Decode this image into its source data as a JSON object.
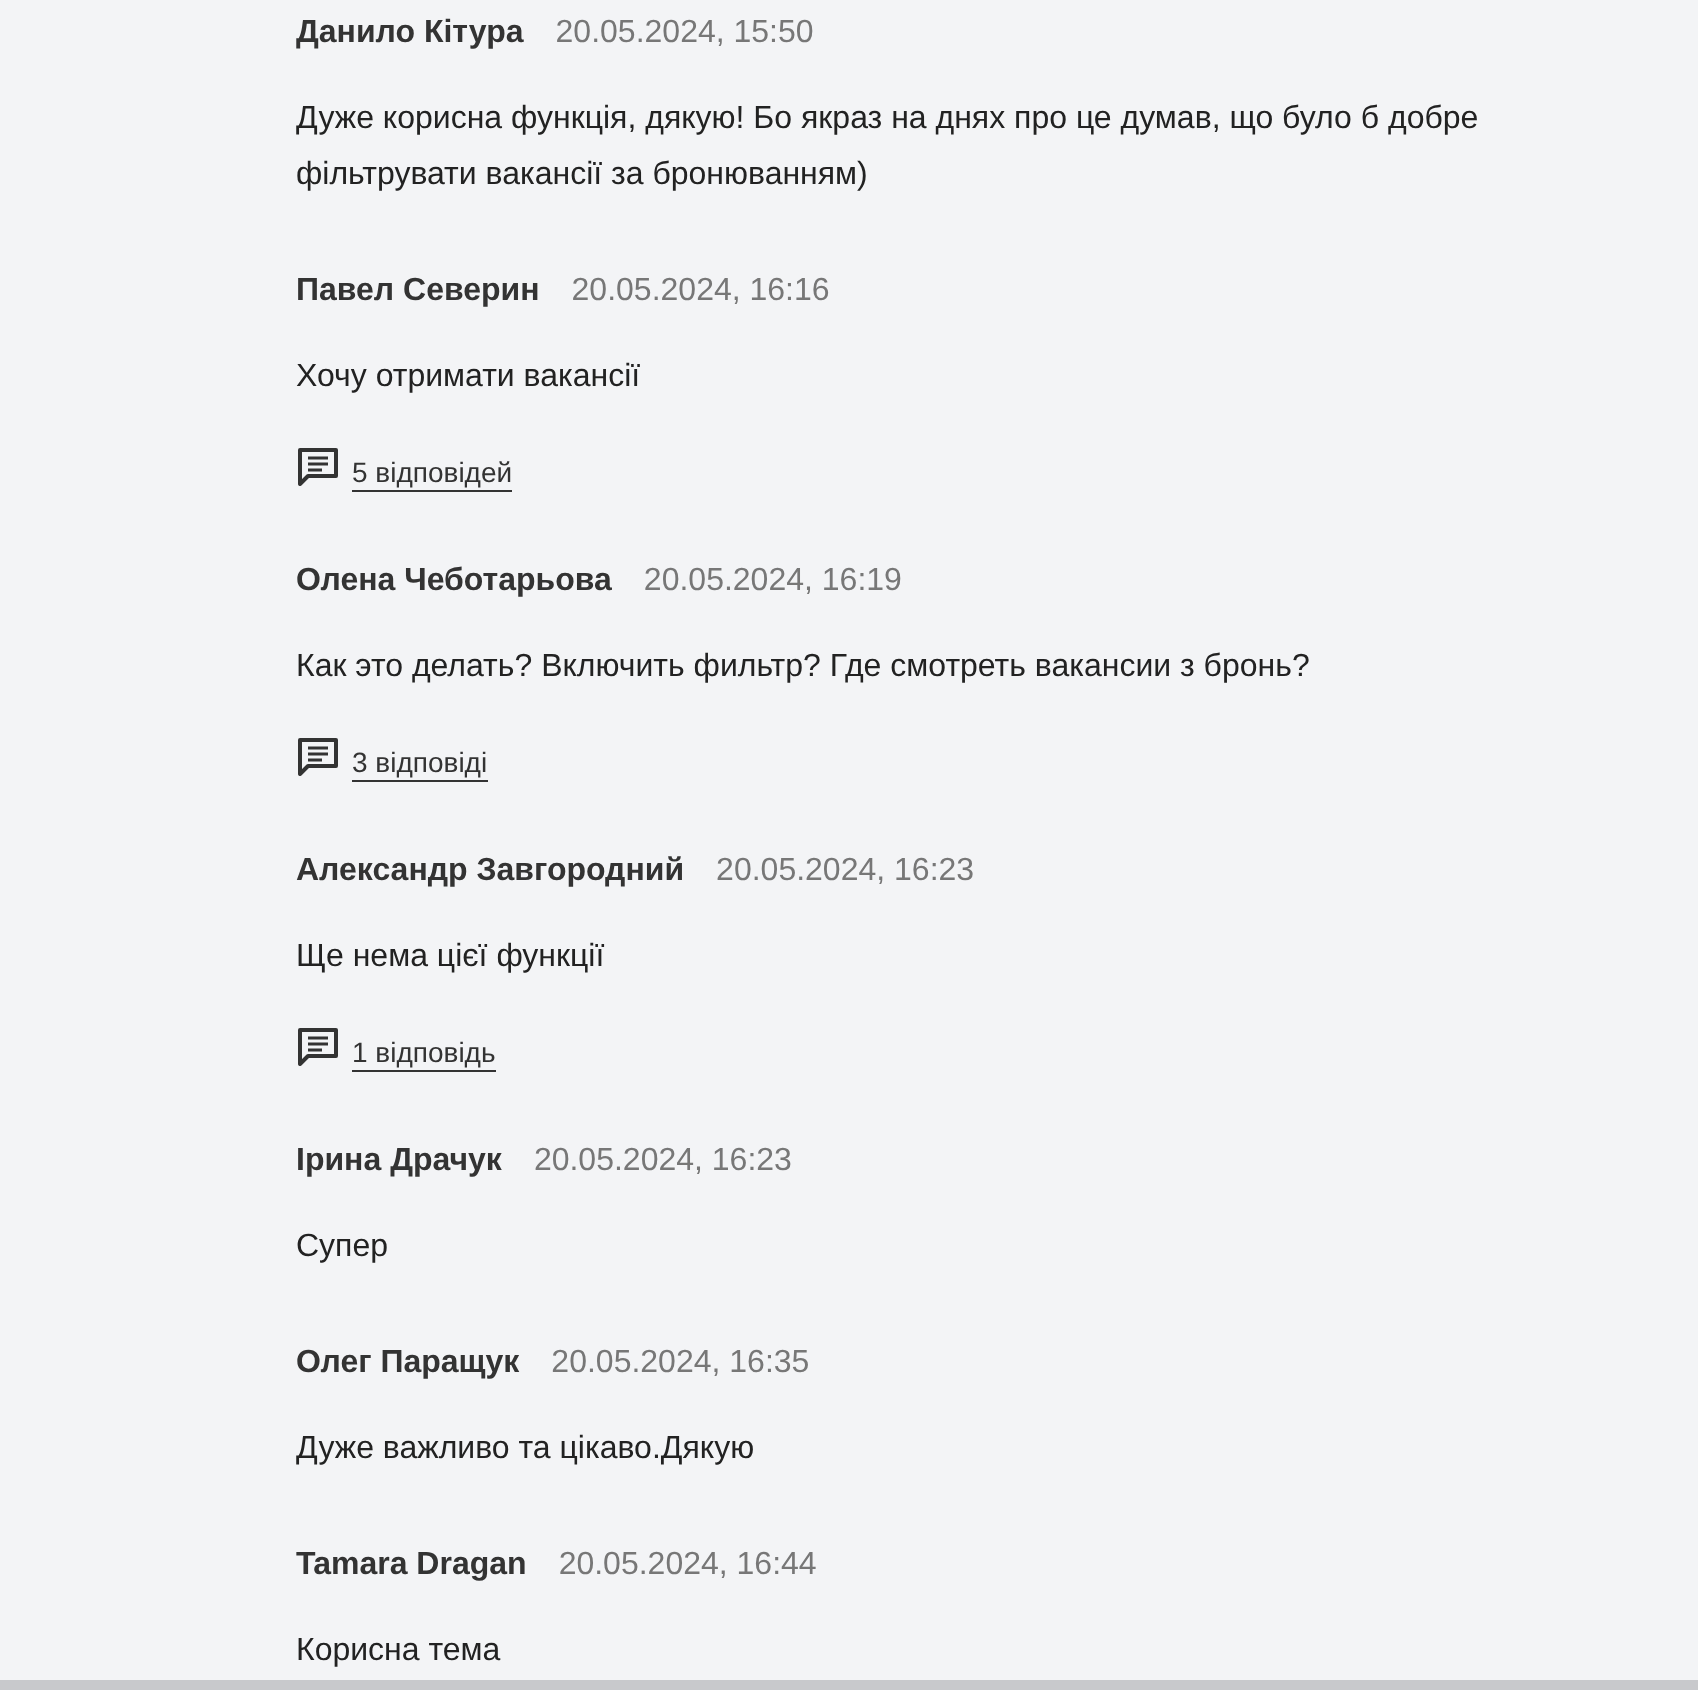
{
  "comments": [
    {
      "author": "Данило Кітура",
      "date": "20.05.2024, 15:50",
      "text": "Дуже корисна функція, дякую! Бо якраз на днях про це думав, що було б добре фільтрувати вакансії за бронюванням)"
    },
    {
      "author": "Павел Северин",
      "date": "20.05.2024, 16:16",
      "text": "Хочу отримати вакансії",
      "replies": "5 відповідей"
    },
    {
      "author": "Олена Чеботарьова",
      "date": "20.05.2024, 16:19",
      "text": "Как это делать? Включить фильтр? Где смотреть вакансии з бронь?",
      "replies": "3 відповіді"
    },
    {
      "author": "Александр Завгородний",
      "date": "20.05.2024, 16:23",
      "text": "Ще нема цієї функції",
      "replies": "1 відповідь"
    },
    {
      "author": "Ірина Драчук",
      "date": "20.05.2024, 16:23",
      "text": "Супер"
    },
    {
      "author": "Олег Паращук",
      "date": "20.05.2024, 16:35",
      "text": "Дуже важливо та цікаво.Дякую"
    },
    {
      "author": "Tamara Dragan",
      "date": "20.05.2024, 16:44",
      "text": "Корисна тема"
    }
  ]
}
